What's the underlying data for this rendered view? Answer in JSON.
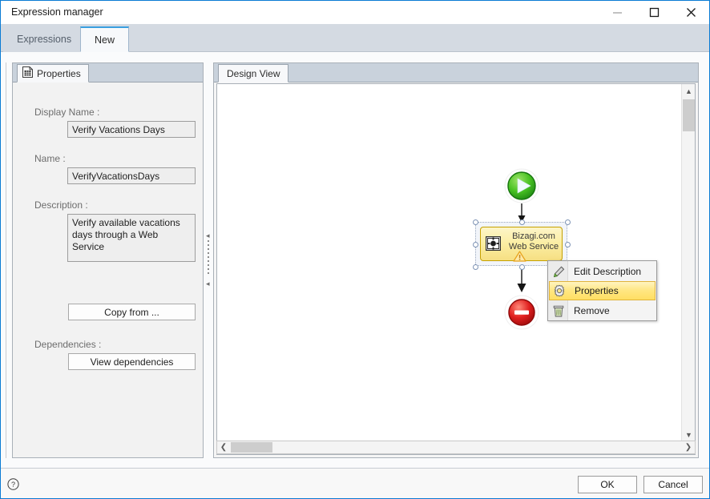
{
  "window": {
    "title": "Expression manager",
    "controls": {
      "minimize": "minimize-icon",
      "maximize": "maximize-icon",
      "close": "close-icon"
    },
    "accent_color": "#0a7bd4"
  },
  "tabs": {
    "items": [
      {
        "label": "Expressions",
        "active": false
      },
      {
        "label": "New",
        "active": true
      }
    ]
  },
  "properties_panel": {
    "tab_label": "Properties",
    "tab_icon": "properties-grid-icon",
    "fields": [
      {
        "label": "Display Name :",
        "value": "Verify Vacations Days"
      },
      {
        "label": "Name :",
        "value": "VerifyVacationsDays"
      },
      {
        "label": "Description :",
        "value": "Verify available vacations days through a Web Service"
      }
    ],
    "copy_from_button": "Copy from ...",
    "dependencies_label": "Dependencies :",
    "view_dependencies_button": "View dependencies"
  },
  "design_panel": {
    "tab_label": "Design View",
    "diagram": {
      "start_node": {
        "name": "start-event",
        "icon": "play-icon",
        "color": "#3cb329"
      },
      "task_node": {
        "name": "web-service-task",
        "label_line1": "Bizagi.com",
        "label_line2": "Web Service",
        "icon": "web-service-icon",
        "warning_icon": "warning-triangle-icon",
        "selected": true,
        "fill_color": "#fbeea4",
        "border_color": "#c6a100"
      },
      "end_node": {
        "name": "end-event",
        "icon": "stop-icon",
        "color": "#d91f1f"
      },
      "connectors": 2
    },
    "scrollbars": {
      "vertical": {
        "up": "chevron-up-icon",
        "down": "chevron-down-icon"
      },
      "horizontal": {
        "left": "chevron-left-icon",
        "right": "chevron-right-icon"
      }
    }
  },
  "context_menu": {
    "items": [
      {
        "label": "Edit Description",
        "icon": "pencil-icon",
        "selected": false
      },
      {
        "label": "Properties",
        "icon": "gear-icon",
        "selected": true
      },
      {
        "label": "Remove",
        "icon": "trash-icon",
        "selected": false
      }
    ],
    "highlight_color": "#ffe680"
  },
  "footer": {
    "help_icon": "help-question-icon",
    "ok_button": "OK",
    "cancel_button": "Cancel"
  }
}
